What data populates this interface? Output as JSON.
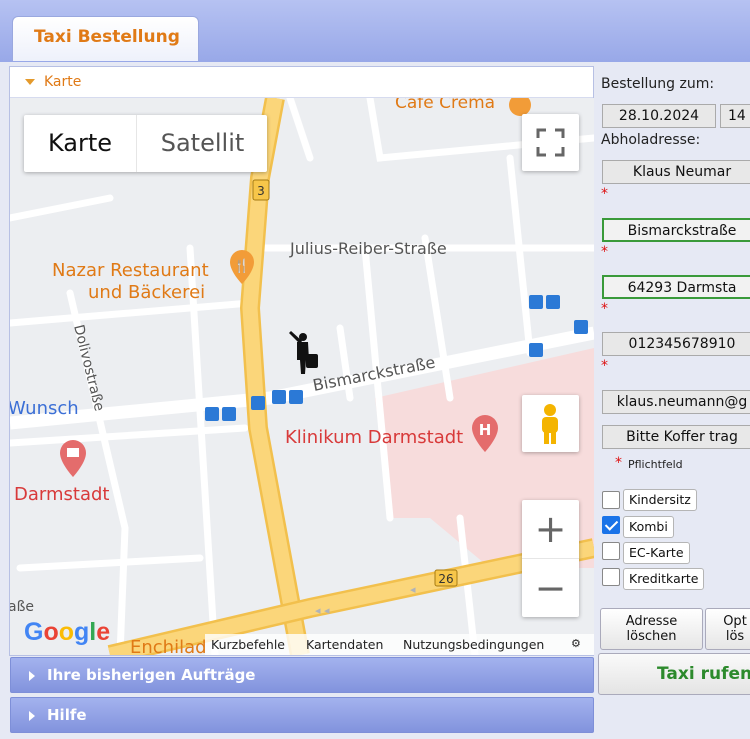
{
  "tab": {
    "title": "Taxi Bestellung"
  },
  "map_panel": {
    "header": "Karte",
    "map_type": {
      "map": "Karte",
      "satellite": "Satellit"
    },
    "labels": {
      "cafe": "Cafe Crema",
      "street_julius": "Julius-Reiber-Straße",
      "restaurant_line1": "Nazar Restaurant",
      "restaurant_line2": "und Bäckerei",
      "street_dolivo": "Dolivostraße",
      "street_bismarck": "Bismarckstraße",
      "wunsch": "Wunsch",
      "klinikum": "Klinikum Darmstadt",
      "darmstadt": "Darmstadt",
      "road_3": "3",
      "road_26": "26",
      "strasse_partial": "aße",
      "enchilada": "Enchilad"
    },
    "attribution": {
      "shortcuts": "Kurzbefehle",
      "mapdata": "Kartendaten",
      "terms": "Nutzungsbedingungen"
    },
    "google": "Google",
    "zoom_in": "+",
    "zoom_out": "−"
  },
  "accordions": {
    "history": "Ihre bisherigen Aufträge",
    "help": "Hilfe"
  },
  "form": {
    "order_for_label": "Bestellung zum:",
    "date": "28.10.2024",
    "time": "14",
    "pickup_label": "Abholadresse:",
    "name": "Klaus Neumar",
    "street": "Bismarckstraße",
    "city": "64293 Darmsta",
    "phone": "012345678910",
    "email": "klaus.neumann@g",
    "note": "Bitte Koffer trag",
    "required_star": "*",
    "required_note": "Pflichtfeld",
    "options": [
      {
        "label": "Kindersitz",
        "checked": false
      },
      {
        "label": "Kombi",
        "checked": true
      },
      {
        "label": "EC-Karte",
        "checked": false
      },
      {
        "label": "Kreditkarte",
        "checked": false
      }
    ],
    "btn_clear_address_l1": "Adresse",
    "btn_clear_address_l2": "löschen",
    "btn_clear_options_l1": "Opt",
    "btn_clear_options_l2": "lös",
    "btn_call_taxi": "Taxi rufen"
  },
  "colors": {
    "accent": "#e07a16",
    "tab_bar": "#98a8e8",
    "call_taxi": "#2c8a2c"
  }
}
